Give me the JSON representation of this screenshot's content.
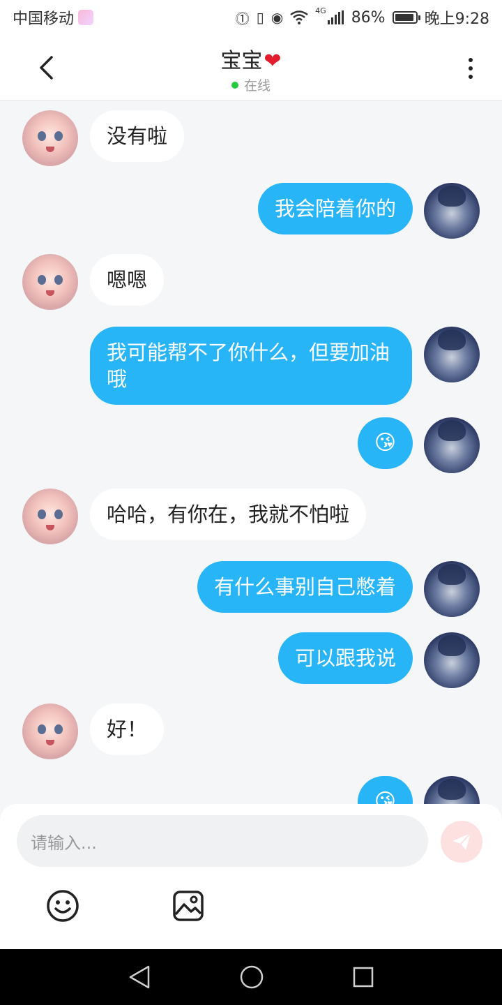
{
  "status_bar": {
    "carrier": "中国移动",
    "network": "4G",
    "battery": "86%",
    "time": "晚上9:28"
  },
  "header": {
    "title": "宝宝",
    "title_emoji": "❤",
    "status": "在线"
  },
  "messages": [
    {
      "side": "in",
      "text": "没有啦"
    },
    {
      "side": "out",
      "text": "我会陪着你的"
    },
    {
      "side": "in",
      "text": "嗯嗯"
    },
    {
      "side": "out",
      "text": "我可能帮不了你什么，但要加油哦"
    },
    {
      "side": "out",
      "text": "😘"
    },
    {
      "side": "in",
      "text": "哈哈，有你在，我就不怕啦"
    },
    {
      "side": "out",
      "text": "有什么事别自己憋着"
    },
    {
      "side": "out",
      "text": "可以跟我说"
    },
    {
      "side": "in",
      "text": "好！"
    },
    {
      "side": "out",
      "text": "😘"
    }
  ],
  "input": {
    "placeholder": "请输入..."
  },
  "colors": {
    "outgoing_bubble": "#28b5f7",
    "incoming_bubble": "#ffffff",
    "background": "#f4f6f8",
    "online_dot": "#27c93f",
    "send_button": "#fde0e0"
  },
  "icons": {
    "back": "chevron-left-icon",
    "more": "more-vertical-icon",
    "emoji": "smiley-icon",
    "image": "image-icon",
    "send": "paper-plane-icon"
  }
}
